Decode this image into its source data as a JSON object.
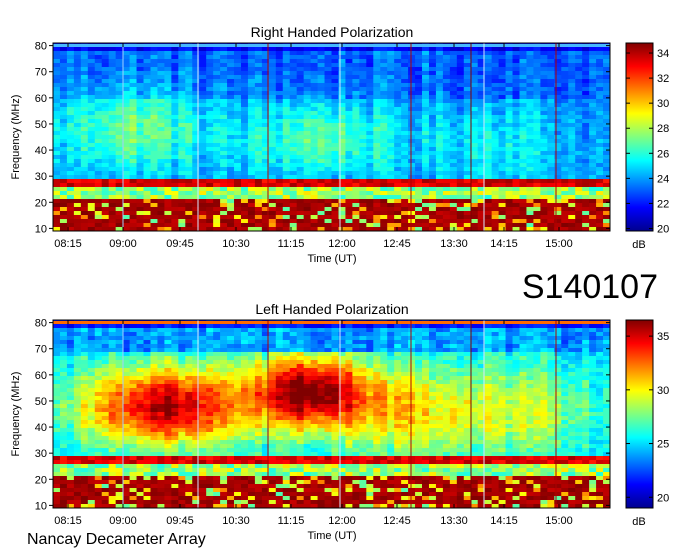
{
  "figure": {
    "code": "S140107",
    "instrument": "Nancay Decameter Array"
  },
  "chart_data": [
    {
      "type": "heatmap",
      "title": "Right Handed Polarization",
      "xlabel": "Time (UT)",
      "ylabel": "Frequency (MHz)",
      "xticks": [
        "08:15",
        "09:00",
        "09:45",
        "10:30",
        "11:15",
        "12:00",
        "12:45",
        "13:30",
        "14:15",
        "15:00"
      ],
      "yticks": [
        10,
        20,
        30,
        40,
        50,
        60,
        70,
        80
      ],
      "ylim": [
        9,
        81
      ],
      "colorbar": {
        "label": "dB",
        "range": [
          19.8,
          34.8
        ],
        "ticks": [
          20,
          22,
          24,
          26,
          28,
          30,
          32,
          34
        ]
      }
    },
    {
      "type": "heatmap",
      "title": "Left Handed Polarization",
      "xlabel": "Time (UT)",
      "ylabel": "Frequency (MHz)",
      "xticks": [
        "08:15",
        "09:00",
        "09:45",
        "10:30",
        "11:15",
        "12:00",
        "12:45",
        "13:30",
        "14:15",
        "15:00"
      ],
      "yticks": [
        10,
        20,
        30,
        40,
        50,
        60,
        70,
        80
      ],
      "ylim": [
        9,
        81
      ],
      "colorbar": {
        "label": "dB",
        "range": [
          19,
          36.5
        ],
        "ticks": [
          20,
          25,
          30,
          35
        ]
      }
    }
  ]
}
